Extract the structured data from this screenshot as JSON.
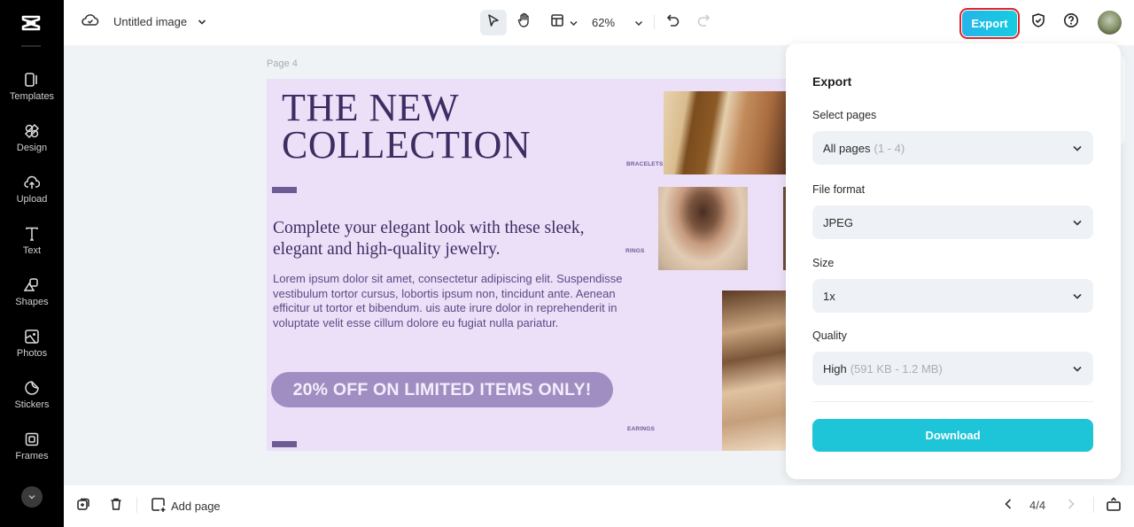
{
  "app": {
    "logo_icon": "capcut-logo-icon"
  },
  "sidebar": {
    "items": [
      {
        "label": "Templates",
        "icon": "templates-icon"
      },
      {
        "label": "Design",
        "icon": "design-icon"
      },
      {
        "label": "Upload",
        "icon": "upload-icon"
      },
      {
        "label": "Text",
        "icon": "text-icon"
      },
      {
        "label": "Shapes",
        "icon": "shapes-icon"
      },
      {
        "label": "Photos",
        "icon": "photos-icon"
      },
      {
        "label": "Stickers",
        "icon": "stickers-icon"
      },
      {
        "label": "Frames",
        "icon": "frames-icon"
      }
    ],
    "more_icon": "chevron-down-icon"
  },
  "topbar": {
    "cloud_icon": "cloud-sync-icon",
    "title": "Untitled image",
    "zoom_level": "62%",
    "export_label": "Export",
    "colors": {
      "export": "#1ec4d8",
      "highlight": "#e0242b"
    }
  },
  "canvas": {
    "page_label": "Page 4",
    "design": {
      "headline_line1": "THE NEW",
      "headline_line2": "COLLECTION",
      "subhead": "Complete your elegant look with these sleek, elegant and high-quality jewelry.",
      "body": "Lorem ipsum dolor sit amet, consectetur adipiscing elit. Suspendisse vestibulum tortor cursus, lobortis ipsum non, tincidunt ante. Aenean efficitur ut tortor et bibendum. uis aute irure dolor in reprehenderit in voluptate velit esse cillum dolore eu fugiat nulla pariatur.",
      "promo": "20% OFF ON LIMITED ITEMS ONLY!",
      "tags": {
        "bracelets": "BRACELETS",
        "rings": "RINGS",
        "earings": "EARINGS"
      },
      "colors": {
        "background": "#ecdff8",
        "primary": "#3c2d62",
        "accent": "#a08ec3"
      }
    }
  },
  "export_panel": {
    "title": "Export",
    "select_pages": {
      "label": "Select pages",
      "value": "All pages",
      "hint": "(1 - 4)"
    },
    "file_format": {
      "label": "File format",
      "value": "JPEG"
    },
    "size": {
      "label": "Size",
      "value": "1x"
    },
    "quality": {
      "label": "Quality",
      "value": "High",
      "hint": "(591 KB - 1.2 MB)"
    },
    "download_label": "Download"
  },
  "bottombar": {
    "add_page_label": "Add page",
    "page_indicator": "4/4"
  }
}
